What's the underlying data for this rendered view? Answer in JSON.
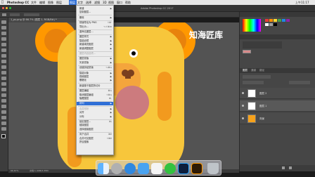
{
  "system_menubar": {
    "app_name": "Photoshop CC",
    "items": [
      "文件",
      "编辑",
      "图像",
      "图层",
      "文字",
      "选择",
      "滤镜",
      "3D",
      "视图",
      "窗口",
      "帮助"
    ],
    "clock": "上午11:17"
  },
  "app_window": {
    "title": "Adobe Photoshop CC 2017"
  },
  "document_tab": {
    "label": "1_ps.png @ 66.7% (图层 1, RGB/8#) *"
  },
  "status_bar": {
    "zoom": "66.67%",
    "doc_info": "文档:1.40M/3.35M"
  },
  "watermark": {
    "text": "知海匠库"
  },
  "layers_panel": {
    "tabs": [
      "图层",
      "通道",
      "路径"
    ],
    "layers": [
      {
        "name": "图层 2"
      },
      {
        "name": "图层 1"
      },
      {
        "name": "背景"
      }
    ]
  },
  "image_menu": {
    "items": [
      {
        "label": "新建",
        "shortcut": "",
        "submenu": true,
        "disabled": false
      },
      {
        "label": "复制图层...",
        "shortcut": "",
        "submenu": false,
        "disabled": false
      },
      {
        "label": "删除",
        "shortcut": "",
        "submenu": true,
        "disabled": false
      },
      {
        "label": "快速导出为 PNG",
        "shortcut": "⇧⌘'",
        "submenu": false,
        "disabled": false
      },
      {
        "label": "导出为...",
        "shortcut": "⌥⇧⌘W",
        "submenu": false,
        "disabled": false
      },
      {
        "label": "重命名图层...",
        "shortcut": "",
        "submenu": false,
        "disabled": false
      },
      {
        "label": "图层样式",
        "shortcut": "",
        "submenu": true,
        "disabled": false
      },
      {
        "label": "智能滤镜",
        "shortcut": "",
        "submenu": true,
        "disabled": false
      },
      {
        "label": "新建填充图层",
        "shortcut": "",
        "submenu": true,
        "disabled": false
      },
      {
        "label": "新建调整图层",
        "shortcut": "",
        "submenu": true,
        "disabled": false
      },
      {
        "label": "图层内容选项...",
        "shortcut": "",
        "submenu": false,
        "disabled": true
      },
      {
        "label": "图层蒙版",
        "shortcut": "",
        "submenu": true,
        "disabled": false
      },
      {
        "label": "矢量蒙版",
        "shortcut": "",
        "submenu": true,
        "disabled": false
      },
      {
        "label": "创建剪贴蒙版",
        "shortcut": "⌥⌘G",
        "submenu": false,
        "disabled": false
      },
      {
        "label": "智能对象",
        "shortcut": "",
        "submenu": true,
        "disabled": false
      },
      {
        "label": "视频图层",
        "shortcut": "",
        "submenu": true,
        "disabled": false
      },
      {
        "label": "栅格化",
        "shortcut": "",
        "submenu": true,
        "disabled": false
      },
      {
        "label": "新建基于图层的切片",
        "shortcut": "",
        "submenu": false,
        "disabled": false
      },
      {
        "label": "图层编组",
        "shortcut": "⌘G",
        "submenu": false,
        "disabled": false
      },
      {
        "label": "取消图层编组",
        "shortcut": "⇧⌘G",
        "submenu": false,
        "disabled": false
      },
      {
        "label": "隐藏图层",
        "shortcut": "⌘,",
        "submenu": false,
        "disabled": false
      },
      {
        "label": "排列",
        "shortcut": "",
        "submenu": true,
        "disabled": false,
        "highlighted": true
      },
      {
        "label": "合并形状",
        "shortcut": "",
        "submenu": true,
        "disabled": true
      },
      {
        "label": "对齐",
        "shortcut": "",
        "submenu": true,
        "disabled": false
      },
      {
        "label": "分布",
        "shortcut": "",
        "submenu": true,
        "disabled": false
      },
      {
        "label": "锁定图层...",
        "shortcut": "⌘/",
        "submenu": false,
        "disabled": false
      },
      {
        "label": "链接图层",
        "shortcut": "",
        "submenu": false,
        "disabled": false
      },
      {
        "label": "选择链接图层",
        "shortcut": "",
        "submenu": false,
        "disabled": false
      },
      {
        "label": "向下合并",
        "shortcut": "⌘E",
        "submenu": false,
        "disabled": false
      },
      {
        "label": "合并可见图层",
        "shortcut": "⇧⌘E",
        "submenu": false,
        "disabled": false
      },
      {
        "label": "拼合图像",
        "shortcut": "",
        "submenu": false,
        "disabled": false
      }
    ]
  },
  "colors": {
    "bear_body": "#f7c63b",
    "bear_ear_outer": "#ff9800",
    "bear_ear_inner": "#e8820c",
    "muzzle": "#f4a53c",
    "nose": "#7b3f1e",
    "circle": "#cc7b7e",
    "shadow_orange": "#f29a1e"
  },
  "dock_icons": [
    "finder-icon",
    "launchpad-icon",
    "safari-icon",
    "mail-icon",
    "calendar-icon",
    "wechat-icon",
    "photoshop-icon",
    "illustrator-icon",
    "trash-icon"
  ]
}
